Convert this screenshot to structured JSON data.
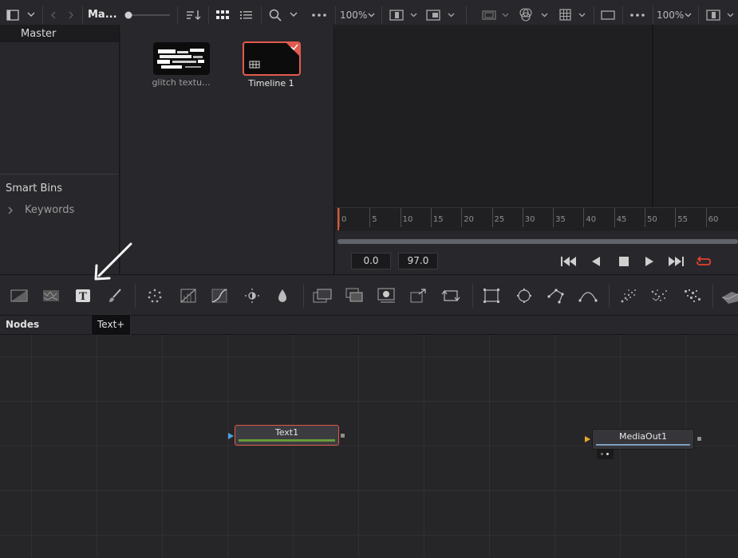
{
  "toolbar": {
    "bin_title": "Ma...",
    "zoom_left": "100%",
    "zoom_right": "100%"
  },
  "bins": {
    "master_label": "Master",
    "smart_bins_label": "Smart Bins",
    "keywords_label": "Keywords"
  },
  "media_pool": {
    "clips": [
      {
        "name": "glitch textu..."
      },
      {
        "name": "Timeline 1"
      }
    ]
  },
  "viewer": {
    "ruler_labels": [
      "0",
      "5",
      "10",
      "15",
      "20",
      "25",
      "30",
      "35",
      "40",
      "45",
      "50",
      "55",
      "60"
    ],
    "timecode_in": "0.0",
    "timecode_out": "97.0"
  },
  "fx_toolbar": {
    "tooltip": "Text+"
  },
  "nodes": {
    "title": "Nodes",
    "node_text1": "Text1",
    "node_mediaout": "MediaOut1"
  },
  "colors": {
    "accent_selected": "#e25a4e",
    "playhead": "#e0572a",
    "text_bar": "#6a9c3c",
    "loop_icon": "#e0412f"
  }
}
